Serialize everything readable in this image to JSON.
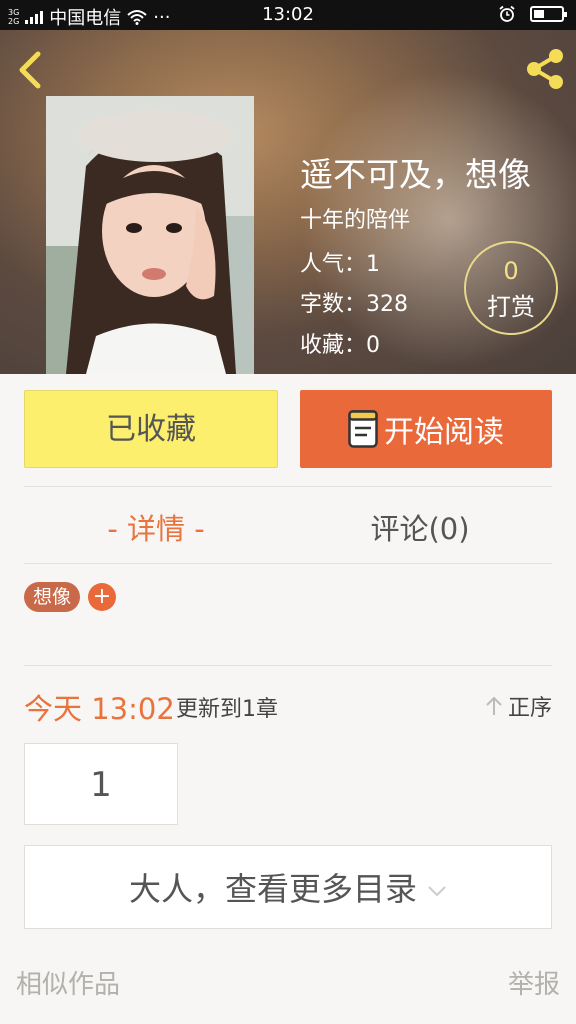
{
  "status_bar": {
    "net_top": "3G",
    "net_bottom": "2G",
    "carrier": "中国电信",
    "more": "···",
    "time": "13:02"
  },
  "book": {
    "title": "遥不可及，想像",
    "subtitle": "十年的陪伴",
    "popularity": "人气：1",
    "word_count": "字数：328",
    "favorites": "收藏：0",
    "reward_count": "0",
    "reward_label": "打赏"
  },
  "actions": {
    "favorited_label": "已收藏",
    "read_label": "开始阅读"
  },
  "tabs": {
    "detail": "- 详情 -",
    "comments": "评论(0)"
  },
  "tags": {
    "items": [
      "想像"
    ],
    "add": "+"
  },
  "update": {
    "date": "今天 13:02",
    "text": "更新到1章",
    "order_label": "正序"
  },
  "chapters": {
    "first": "1",
    "more_label": "大人，查看更多目录"
  },
  "footer": {
    "similar": "相似作品",
    "report": "举报"
  },
  "colors": {
    "accent": "#e9693b",
    "favorite_bg": "#fcef6e",
    "tag_bg": "#c8694a"
  },
  "icons": [
    "back-icon",
    "share-icon",
    "book-icon",
    "arrow-up-icon",
    "chevron-down-icon",
    "alarm-icon",
    "wifi-icon",
    "battery-icon"
  ]
}
